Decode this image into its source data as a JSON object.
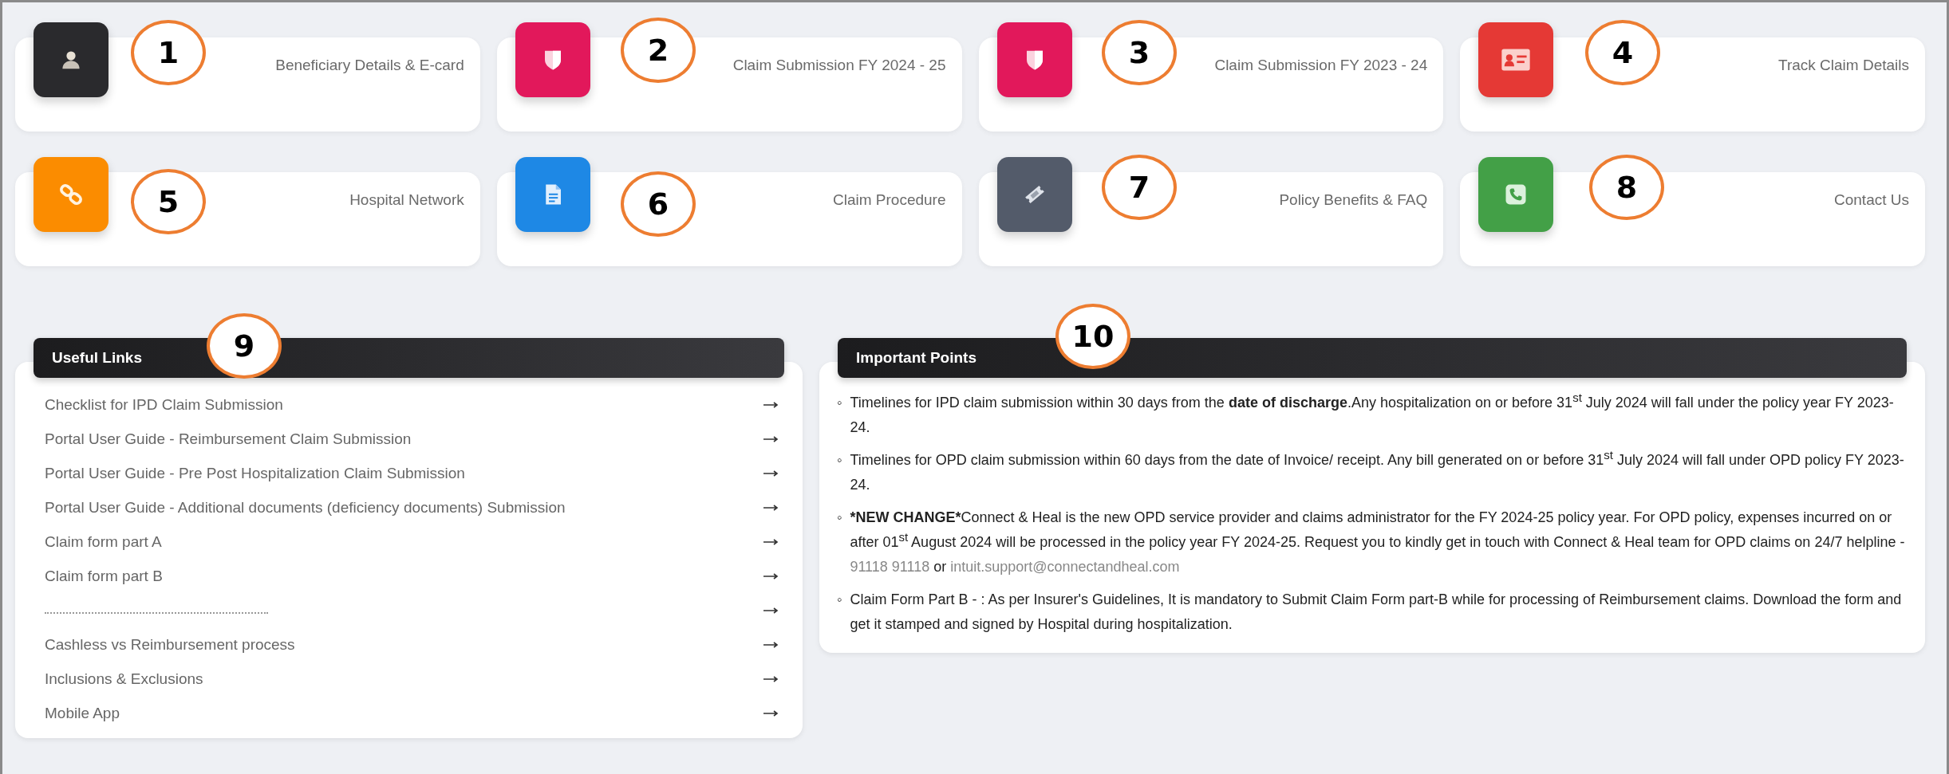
{
  "cards": [
    {
      "title": "Beneficiary Details & E-card",
      "kind": "person",
      "color": "#2a2a2d"
    },
    {
      "title": "Claim Submission FY 2024 - 25",
      "kind": "shield",
      "color": "#e2185b"
    },
    {
      "title": "Claim Submission FY 2023 - 24",
      "kind": "shield",
      "color": "#e2185b"
    },
    {
      "title": "Track Claim Details",
      "kind": "idcard",
      "color": "#e53935"
    },
    {
      "title": "Hospital Network",
      "kind": "link",
      "color": "#fb8c00"
    },
    {
      "title": "Claim Procedure",
      "kind": "document",
      "color": "#1e88e5"
    },
    {
      "title": "Policy Benefits & FAQ",
      "kind": "ticket",
      "color": "#535b6a"
    },
    {
      "title": "Contact Us",
      "kind": "phone",
      "color": "#43a047"
    }
  ],
  "useful_links": {
    "title": "Useful Links",
    "items": [
      {
        "label": "Checklist for IPD Claim Submission"
      },
      {
        "label": "Portal User Guide - Reimbursement Claim Submission"
      },
      {
        "label": "Portal User Guide - Pre Post Hospitalization Claim Submission"
      },
      {
        "label": "Portal User Guide - Additional documents (deficiency documents) Submission"
      },
      {
        "label": "Claim form part A"
      },
      {
        "label": "Claim form part B"
      },
      {
        "kind": "obscured"
      },
      {
        "label": "Cashless vs Reimbursement process"
      },
      {
        "label": "Inclusions & Exclusions"
      },
      {
        "label": "Mobile App"
      }
    ]
  },
  "important_points": {
    "title": "Important Points",
    "items": [
      {
        "marker": "◦",
        "segments": [
          {
            "kind": "text",
            "text": "Timelines for IPD claim submission within 30 days from the **date of discharge**.Any hospitalization on or before 31$^{st}$ July 2024 will fall under the policy year FY 2023-24."
          }
        ]
      },
      {
        "marker": "◦",
        "segments": [
          {
            "kind": "text",
            "text": "Timelines for OPD claim submission within 60 days from the date of Invoice/ receipt. Any bill generated on or before 31$^{st}$ July 2024 will fall under OPD policy FY 2023-24."
          }
        ]
      },
      {
        "marker": "◦",
        "segments": [
          {
            "kind": "bold",
            "text": "*NEW CHANGE*"
          },
          {
            "kind": "text",
            "text": "Connect & Heal is the new OPD service provider and claims administrator for the FY 2024-25 policy year. For OPD policy, expenses incurred on or after 01$^{st}$ August 2024 will be processed in the policy year FY 2024-25. Request you to kindly get in touch with Connect & Heal team for OPD claims on 24/7 helpline - "
          },
          {
            "kind": "link",
            "text": "91118 91118"
          },
          {
            "kind": "text",
            "text": " or "
          },
          {
            "kind": "link",
            "text": "intuit.support@connectandheal.com"
          }
        ]
      },
      {
        "marker": "◦",
        "segments": [
          {
            "kind": "text",
            "text": "Claim Form Part B - : As per Insurer's Guidelines, It is mandatory to Submit Claim Form part-B while for processing of Reimbursement claims. Download the form and get it stamped and signed by Hospital during hospitalization."
          }
        ]
      }
    ]
  },
  "callouts": [
    {
      "label": "1"
    },
    {
      "label": "2"
    },
    {
      "label": "3"
    },
    {
      "label": "4"
    },
    {
      "label": "5"
    },
    {
      "label": "6"
    },
    {
      "label": "7"
    },
    {
      "label": "8"
    },
    {
      "label": "9"
    },
    {
      "label": "10"
    }
  ]
}
